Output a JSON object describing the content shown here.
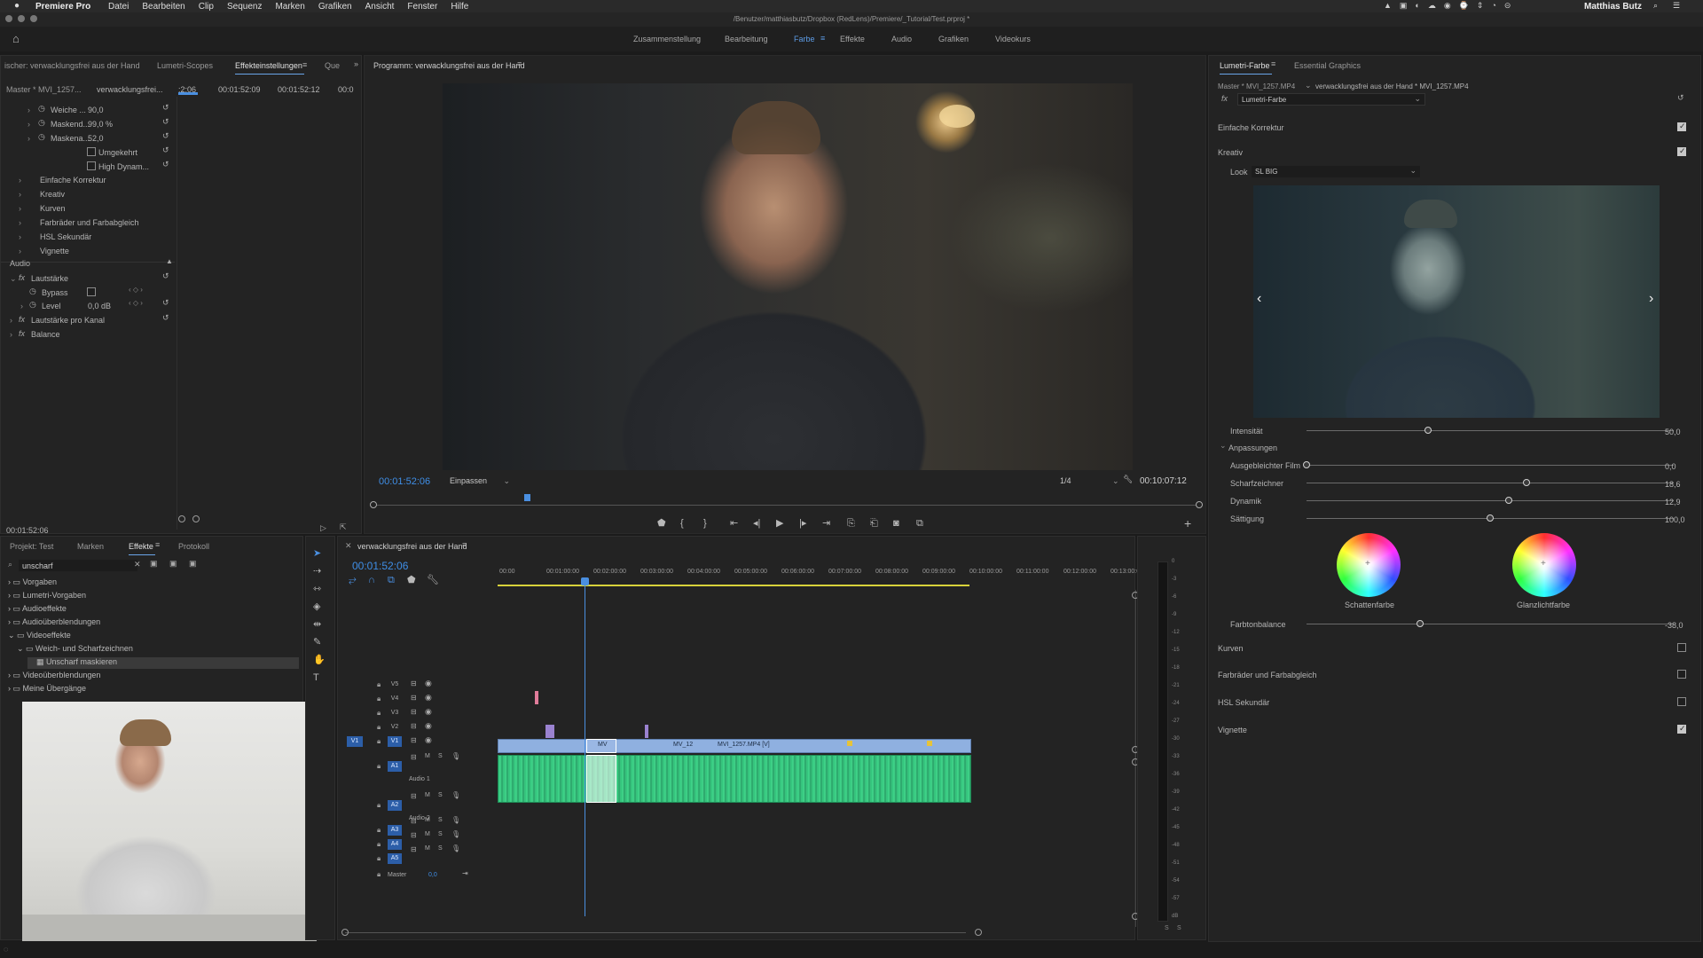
{
  "menubar": {
    "app_name": "Premiere Pro",
    "items": [
      "Datei",
      "Bearbeiten",
      "Clip",
      "Sequenz",
      "Marken",
      "Grafiken",
      "Ansicht",
      "Fenster",
      "Hilfe"
    ],
    "user": "Matthias Butz"
  },
  "window": {
    "title": "/Benutzer/matthiasbutz/Dropbox (RedLens)/Premiere/_Tutorial/Test.prproj *"
  },
  "workspaces": [
    "Zusammenstellung",
    "Bearbeitung",
    "Farbe",
    "Effekte",
    "Audio",
    "Grafiken",
    "Videokurs"
  ],
  "effect_controls": {
    "tabs": [
      "ischer: verwacklungsfrei aus der Hand",
      "Lumetri-Scopes",
      "Effekteinstellungen",
      "Que"
    ],
    "master_label": "Master * MVI_1257...",
    "clip_label": "verwacklungsfrei...",
    "times": [
      ":2:06",
      "00:01:52:09",
      "00:01:52:12",
      "00:0"
    ],
    "rows": {
      "weiche": "Weiche ...",
      "weiche_val": "90,0",
      "maskend": "Maskend...",
      "maskend_val": "99,0 %",
      "maskena": "Maskena...",
      "maskena_val": "52,0",
      "umgekehrt": "Umgekehrt",
      "high_dynamic": "High Dynam..."
    },
    "sections": [
      "Einfache Korrektur",
      "Kreativ",
      "Kurven",
      "Farbräder und Farbabgleich",
      "HSL Sekundär",
      "Vignette"
    ],
    "audio_header": "Audio",
    "lautstaerke": "Lautstärke",
    "bypass": "Bypass",
    "level": "Level",
    "level_val": "0,0 dB",
    "lautstaerke_kanal": "Lautstärke pro Kanal",
    "balance": "Balance",
    "timecode": "00:01:52:06"
  },
  "program": {
    "title": "Programm: verwacklungsfrei aus der Hand",
    "timecode": "00:01:52:06",
    "fit": "Einpassen",
    "resolution": "1/4",
    "duration": "00:10:07:12"
  },
  "lumetri": {
    "tabs": [
      "Lumetri-Farbe",
      "Essential Graphics"
    ],
    "master": "Master * MVI_1257.MP4",
    "clip": "verwacklungsfrei aus der Hand * MVI_1257.MP4",
    "effect": "Lumetri-Farbe",
    "einfache": "Einfache Korrektur",
    "kreativ": "Kreativ",
    "look_label": "Look",
    "look_value": "SL BIG",
    "intensitaet": "Intensität",
    "intensitaet_val": "50,0",
    "intensitaet_pct": 0.33,
    "anpassungen": "Anpassungen",
    "film": "Ausgebleichter Film",
    "film_val": "0,0",
    "film_pct": 0.0,
    "scharf": "Scharfzeichner",
    "scharf_val": "18,6",
    "scharf_pct": 0.6,
    "dynamik": "Dynamik",
    "dynamik_val": "12,9",
    "dynamik_pct": 0.55,
    "saettigung": "Sättigung",
    "saettigung_val": "100,0",
    "saettigung_pct": 0.5,
    "schatten": "Schattenfarbe",
    "glanz": "Glanzlichtfarbe",
    "balance": "Farbtonbalance",
    "balance_val": "-38,0",
    "balance_pct": 0.31,
    "kurven": "Kurven",
    "farbraeder": "Farbräder und Farbabgleich",
    "hsl": "HSL Sekundär",
    "vignette": "Vignette"
  },
  "project": {
    "tabs": [
      "Projekt: Test",
      "Marken",
      "Effekte",
      "Protokoll"
    ],
    "search": "unscharf",
    "tree": [
      "Vorgaben",
      "Lumetri-Vorgaben",
      "Audioeffekte",
      "Audioüberblendungen",
      "Videoeffekte",
      "Weich- und Scharfzeichnen",
      "Unscharf maskieren",
      "Videoüberblendungen",
      "Meine Übergänge"
    ]
  },
  "timeline": {
    "title": "verwacklungsfrei aus der Hand",
    "timecode": "00:01:52:06",
    "ruler": [
      "00:00",
      "00:01:00:00",
      "00:02:00:00",
      "00:03:00:00",
      "00:04:00:00",
      "00:05:00:00",
      "00:06:00:00",
      "00:07:00:00",
      "00:08:00:00",
      "00:09:00:00",
      "00:10:00:00",
      "00:11:00:00",
      "00:12:00:00",
      "00:13:00:00"
    ],
    "video_tracks": [
      "V5",
      "V4",
      "V3",
      "V2",
      "V1"
    ],
    "audio_tracks": [
      "A1",
      "A2",
      "A3",
      "A4",
      "A5"
    ],
    "audio1": "Audio 1",
    "audio2": "Audio 2",
    "master": "Master",
    "master_val": "0,0",
    "clip1": "MV",
    "clip2": "MV_12",
    "clip3": "MVI_1257.MP4 [V]"
  },
  "meter": [
    "0",
    "-3",
    "-6",
    "-9",
    "-12",
    "-15",
    "-18",
    "-21",
    "-24",
    "-27",
    "-30",
    "-33",
    "-36",
    "-39",
    "-42",
    "-45",
    "-48",
    "-51",
    "-54",
    "-57",
    "dB"
  ],
  "meter_footer": [
    "S",
    "S"
  ]
}
